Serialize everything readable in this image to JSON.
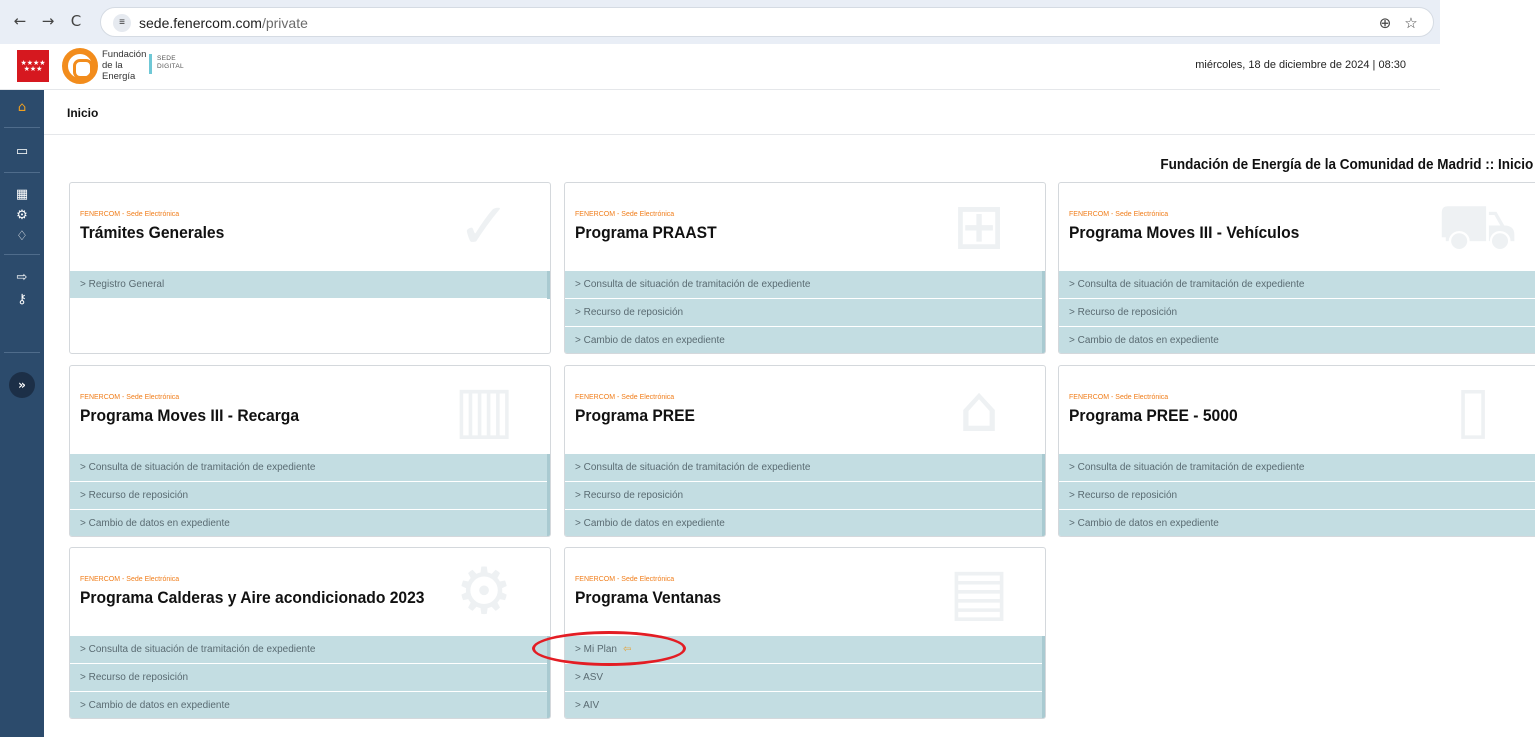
{
  "browser": {
    "back": "←",
    "forward": "→",
    "reload": "C",
    "url_host": "sede.fenercom.com",
    "url_path": "/private",
    "zoom_icon": "⊕",
    "bookmark_icon": "☆"
  },
  "header": {
    "org_name_lines": [
      "Fundación",
      "de la",
      "Energía"
    ],
    "sede_lines": [
      "SEDE",
      "DIGITAL"
    ],
    "datetime": "miércoles, 18 de diciembre de 2024 | 08:30"
  },
  "breadcrumb": "Inicio",
  "page_heading": "Fundación de Energía de la Comunidad de Madrid :: Inicio",
  "cards": [
    {
      "subtitle": "FENERCOM - Sede Electrónica",
      "title": "Trámites Generales",
      "bg_icon": "✓",
      "links": [
        "Registro General"
      ]
    },
    {
      "subtitle": "FENERCOM - Sede Electrónica",
      "title": "Programa PRAAST",
      "bg_icon": "⊞",
      "links": [
        "Consulta de situación de tramitación de expediente",
        "Recurso de reposición",
        "Cambio de datos en expediente"
      ]
    },
    {
      "subtitle": "FENERCOM - Sede Electrónica",
      "title": "Programa Moves III - Vehículos",
      "bg_icon": "⛟",
      "links": [
        "Consulta de situación de tramitación de expediente",
        "Recurso de reposición",
        "Cambio de datos en expediente"
      ]
    },
    {
      "subtitle": "FENERCOM - Sede Electrónica",
      "title": "Programa Moves III - Recarga",
      "bg_icon": "▥",
      "links": [
        "Consulta de situación de tramitación de expediente",
        "Recurso de reposición",
        "Cambio de datos en expediente"
      ]
    },
    {
      "subtitle": "FENERCOM - Sede Electrónica",
      "title": "Programa PREE",
      "bg_icon": "⌂",
      "links": [
        "Consulta de situación de tramitación de expediente",
        "Recurso de reposición",
        "Cambio de datos en expediente"
      ]
    },
    {
      "subtitle": "FENERCOM - Sede Electrónica",
      "title": "Programa PREE - 5000",
      "bg_icon": "▯",
      "links": [
        "Consulta de situación de tramitación de expediente",
        "Recurso de reposición",
        "Cambio de datos en expediente"
      ]
    },
    {
      "subtitle": "FENERCOM - Sede Electrónica",
      "title": "Programa Calderas y Aire acondicionado 2023",
      "bg_icon": "⚙",
      "links": [
        "Consulta de situación de tramitación de expediente",
        "Recurso de reposición",
        "Cambio de datos en expediente"
      ]
    },
    {
      "subtitle": "FENERCOM - Sede Electrónica",
      "title": "Programa Ventanas",
      "bg_icon": "▤",
      "links": [
        "Mi Plan",
        "ASV",
        "AIV"
      ]
    }
  ],
  "link_chevron": ">",
  "external_icon": "⇦",
  "sidebar": {
    "home_icon": "⌂",
    "folder_icon": "▭",
    "calendar_icon": "▦",
    "settings_icon": "⚙",
    "bell_icon": "♢",
    "logout_icon": "⇨",
    "key_icon": "⚷",
    "expand_icon": "»"
  }
}
